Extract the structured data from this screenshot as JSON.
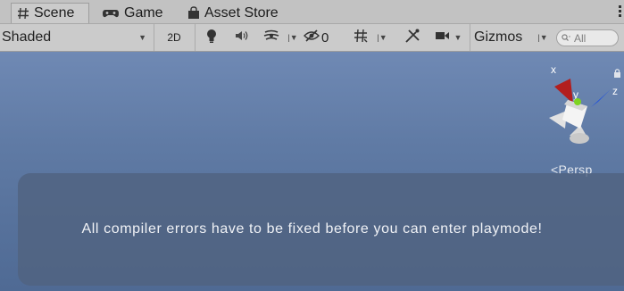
{
  "tabs": [
    {
      "label": "Scene",
      "icon": "scene-icon",
      "active": true
    },
    {
      "label": "Game",
      "icon": "game-controller-icon",
      "active": false
    },
    {
      "label": "Asset Store",
      "icon": "shopping-bag-icon",
      "active": false
    }
  ],
  "toolbar": {
    "draw_mode": "Shaded",
    "mode_2d_label": "2D",
    "hidden_count": "0",
    "gizmos_label": "Gizmos",
    "search_placeholder": "All"
  },
  "scene": {
    "axis_labels": {
      "x": "x",
      "y": "y",
      "z": "z"
    },
    "projection_label": "Persp",
    "notice_text": "All compiler errors have to be fixed before you can enter playmode!"
  },
  "colors": {
    "scene_top": "#6f89b4",
    "scene_bottom": "#4f6a94",
    "axis_x": "#b21e1e",
    "axis_y": "#7ed321",
    "axis_z": "#1c4fe0"
  }
}
